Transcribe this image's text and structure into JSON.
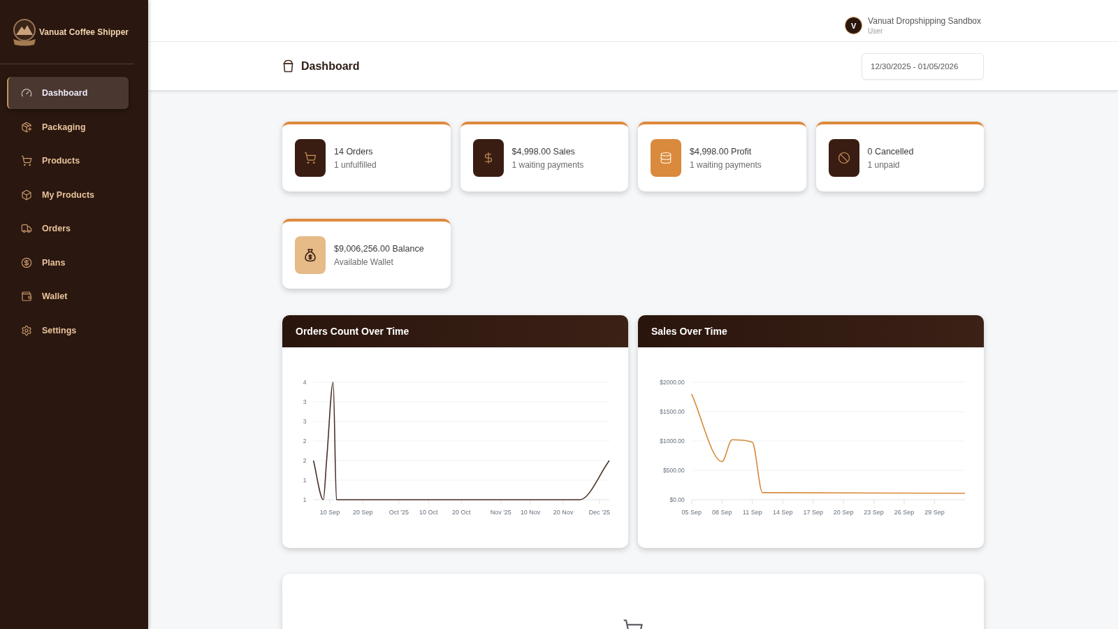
{
  "sidebar": {
    "brand": "Vanuat Coffee Shipper",
    "items": [
      {
        "label": "Dashboard",
        "selected": true
      },
      {
        "label": "Packaging",
        "selected": false
      },
      {
        "label": "Products",
        "selected": false
      },
      {
        "label": "My Products",
        "selected": false
      },
      {
        "label": "Orders",
        "selected": false
      },
      {
        "label": "Plans",
        "selected": false
      },
      {
        "label": "Wallet",
        "selected": false
      },
      {
        "label": "Settings",
        "selected": false
      }
    ]
  },
  "topbar": {
    "user": {
      "initial": "V",
      "name": "Vanuat Dropshipping Sandbox",
      "role": "User"
    }
  },
  "page_header": {
    "title": "Dashboard",
    "date_range": {
      "value": "12/30/2025 - 01/05/2026"
    }
  },
  "stats": [
    {
      "title": "14 Orders",
      "subtitle": "1 unfulfilled",
      "color": "#3a1d12"
    },
    {
      "title": "$4,998.00 Sales",
      "subtitle": "1 waiting payments",
      "color": "#3a1d12"
    },
    {
      "title": "$4,998.00 Profit",
      "subtitle": "1 waiting payments",
      "color": "#d98a3d"
    },
    {
      "title": "0 Cancelled",
      "subtitle": "1 unpaid",
      "color": "#3a1d12"
    },
    {
      "title": "$9,006,256.00 Balance",
      "subtitle": "Available Wallet",
      "color": "#e6bb88"
    }
  ],
  "charts": [
    {
      "chart_data": {
        "type": "line",
        "title": "Orders Count Over Time",
        "grid": true,
        "categories": [
          null,
          null,
          null,
          null,
          null,
          "10 Sep",
          null,
          null,
          null,
          null,
          null,
          null,
          null,
          null,
          null,
          "20 Sep",
          null,
          null,
          null,
          null,
          null,
          null,
          null,
          null,
          null,
          null,
          "Oct '25",
          null,
          null,
          null,
          null,
          null,
          null,
          null,
          null,
          "10 Oct",
          null,
          null,
          null,
          null,
          null,
          null,
          null,
          null,
          null,
          "20 Oct",
          null,
          null,
          null,
          null,
          null,
          null,
          null,
          null,
          null,
          null,
          null,
          "Nov '25",
          null,
          null,
          null,
          null,
          null,
          null,
          null,
          null,
          "10 Nov",
          null,
          null,
          null,
          null,
          null,
          null,
          null,
          null,
          null,
          "20 Nov",
          null,
          null,
          null,
          null,
          null,
          null,
          null,
          null,
          null,
          null,
          "Dec '25",
          null,
          null,
          null
        ],
        "series": [
          {
            "color": "#4a3028",
            "values": [
              2,
              null,
              null,
              1,
              2,
              null,
              4,
              1,
              null,
              null,
              null,
              null,
              null,
              null,
              null,
              null,
              null,
              null,
              null,
              null,
              null,
              null,
              null,
              null,
              null,
              null,
              null,
              null,
              null,
              null,
              null,
              null,
              null,
              null,
              null,
              null,
              null,
              null,
              null,
              null,
              null,
              null,
              null,
              null,
              null,
              null,
              null,
              null,
              null,
              null,
              null,
              null,
              null,
              null,
              null,
              null,
              null,
              null,
              null,
              null,
              null,
              null,
              null,
              null,
              null,
              null,
              null,
              null,
              null,
              null,
              null,
              null,
              null,
              null,
              null,
              null,
              null,
              null,
              null,
              null,
              null,
              1,
              null,
              null,
              null,
              null,
              null,
              null,
              null,
              null,
              2
            ]
          }
        ],
        "ylim": [
          1,
          4
        ],
        "yticks": [
          {
            "value": 1,
            "label": "1"
          },
          {
            "value": 1.5,
            "label": "1"
          },
          {
            "value": 2,
            "label": "2"
          },
          {
            "value": 2.5,
            "label": "2"
          },
          {
            "value": 3,
            "label": "3"
          },
          {
            "value": 3.5,
            "label": "3"
          },
          {
            "value": 4,
            "label": "4"
          }
        ]
      }
    },
    {
      "chart_data": {
        "type": "line",
        "title": "Sales Over Time",
        "grid": true,
        "categories": [
          "05 Sep",
          null,
          null,
          "08 Sep",
          null,
          null,
          "11 Sep",
          null,
          null,
          "14 Sep",
          null,
          null,
          "17 Sep",
          null,
          null,
          "20 Sep",
          null,
          null,
          "23 Sep",
          null,
          null,
          "26 Sep",
          null,
          null,
          "29 Sep",
          null,
          null,
          null
        ],
        "series": [
          {
            "color": "#d98a3d",
            "values": [
              1800,
              null,
              null,
              650,
              1020,
              null,
              980,
              120,
              null,
              null,
              null,
              null,
              null,
              null,
              null,
              null,
              null,
              null,
              null,
              null,
              null,
              null,
              null,
              null,
              null,
              null,
              null,
              110
            ]
          }
        ],
        "ylim": [
          0,
          2000
        ],
        "yticks": [
          {
            "value": 0,
            "label": "$0.00"
          },
          {
            "value": 500,
            "label": "$500.00"
          },
          {
            "value": 1000,
            "label": "$1000.00"
          },
          {
            "value": 1500,
            "label": "$1500.00"
          },
          {
            "value": 2000,
            "label": "$2000.00"
          }
        ]
      }
    }
  ]
}
